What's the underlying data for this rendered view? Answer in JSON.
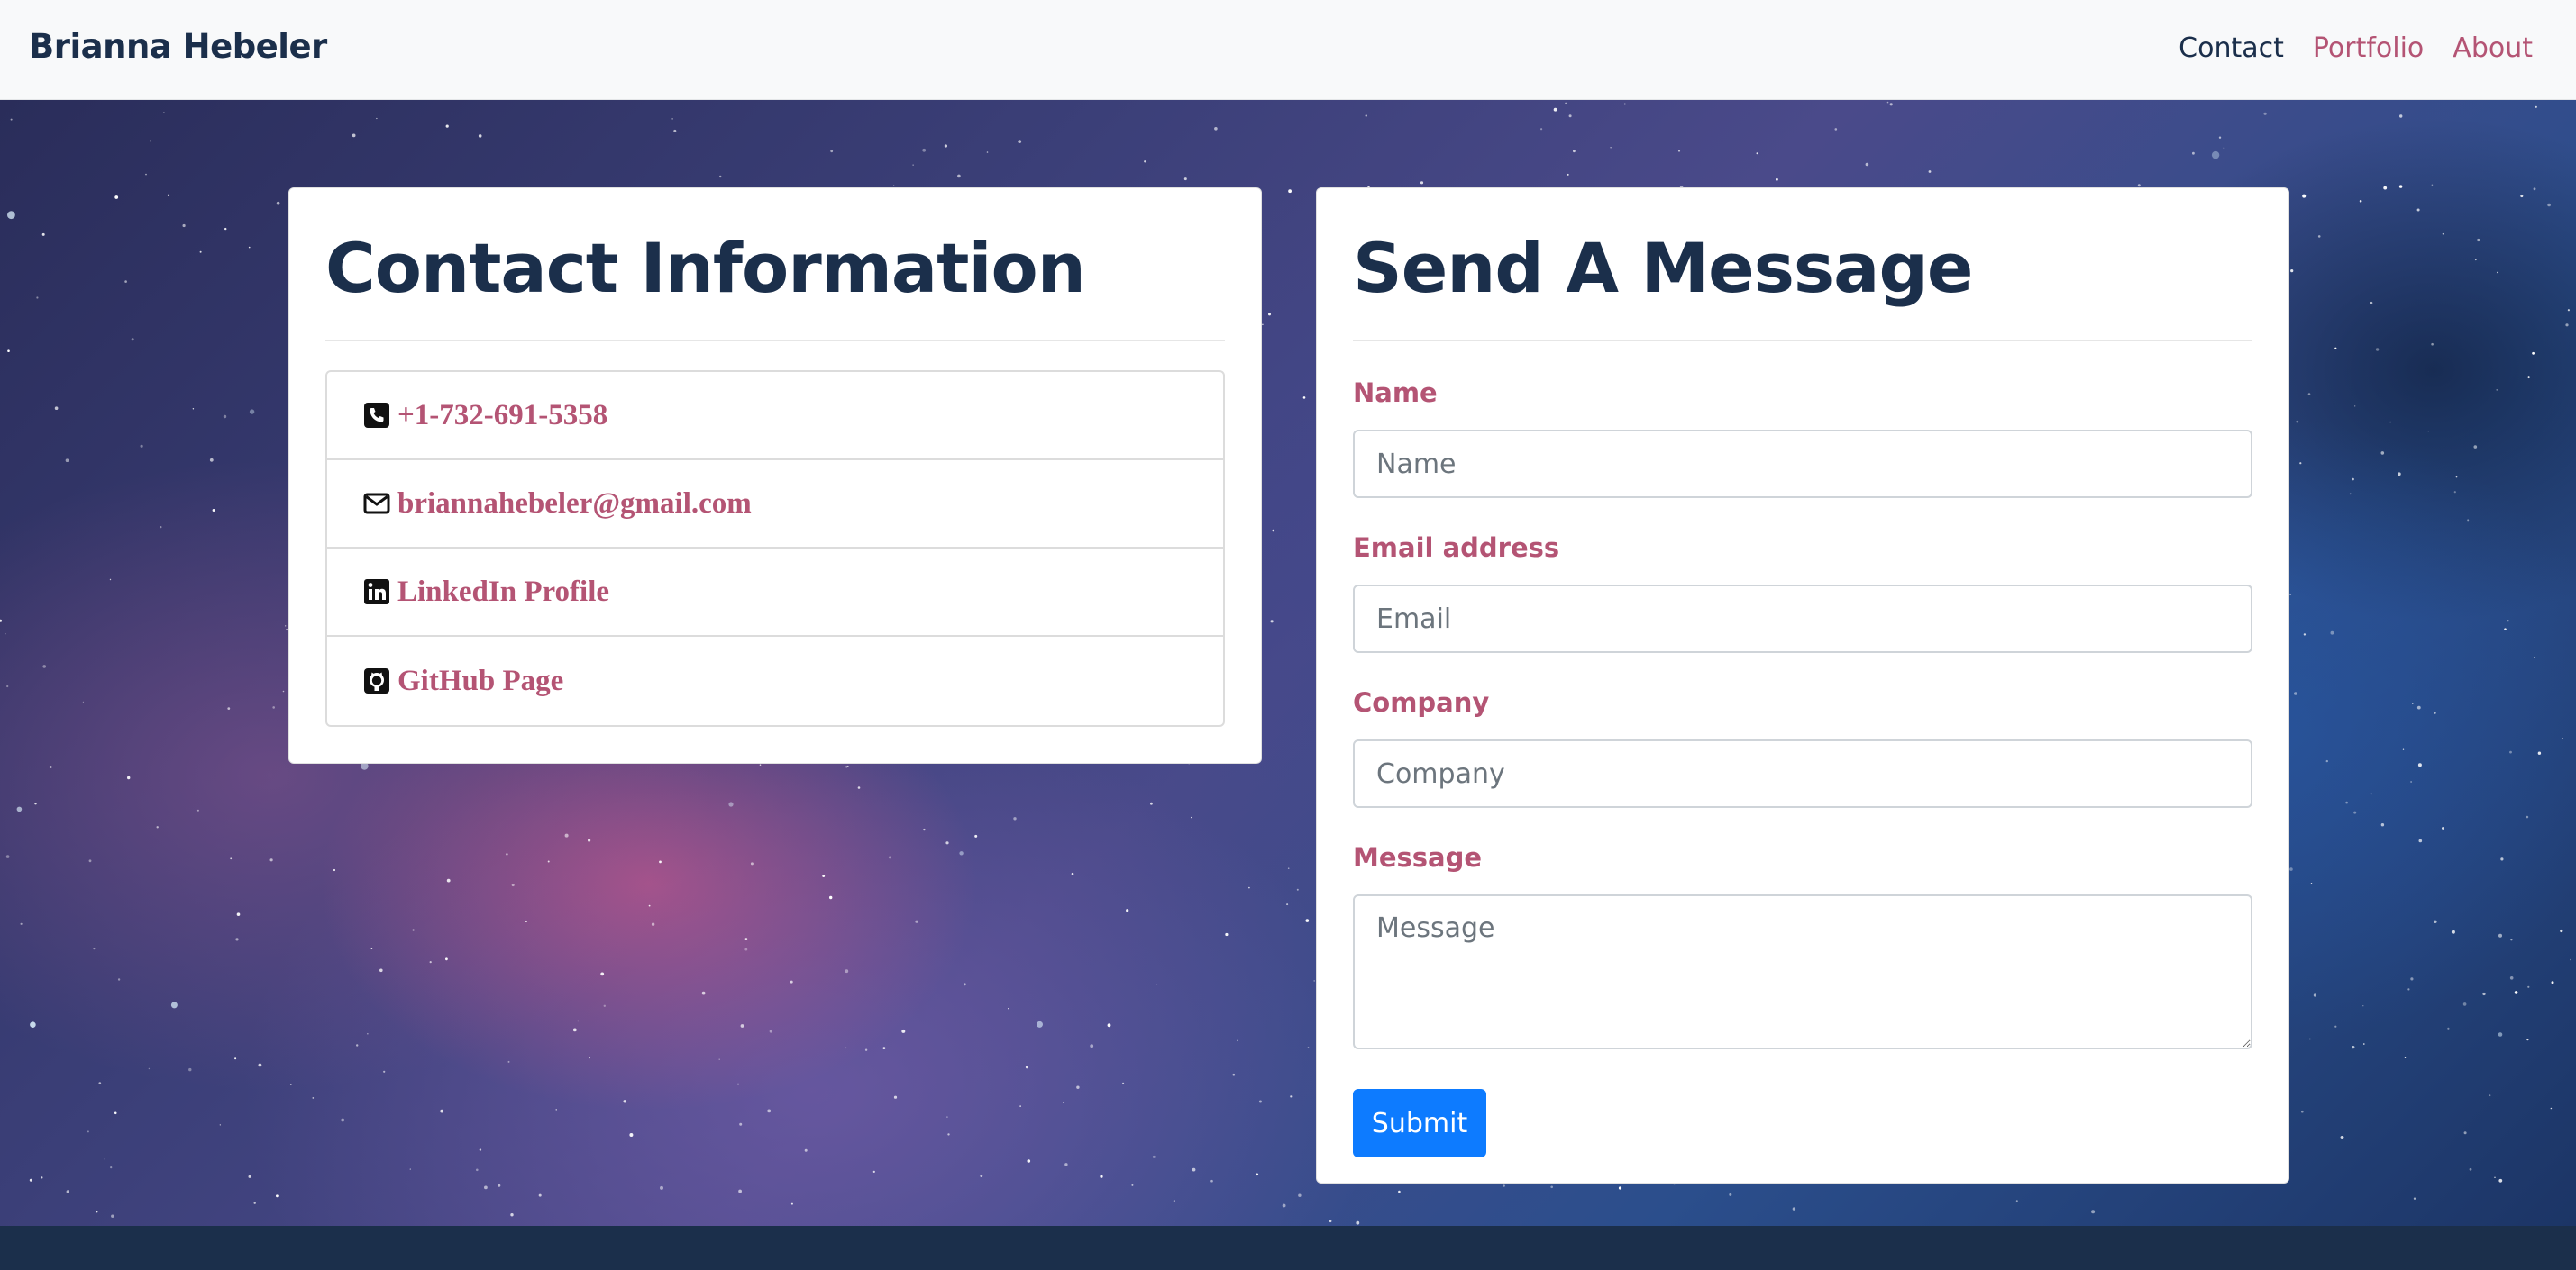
{
  "navbar": {
    "brand": "Brianna Hebeler",
    "links": [
      {
        "label": "Contact",
        "active": true
      },
      {
        "label": "Portfolio",
        "active": false
      },
      {
        "label": "About",
        "active": false
      }
    ]
  },
  "contact_card": {
    "title": "Contact Information",
    "items": [
      {
        "icon": "phone-icon",
        "label": "+1-732-691-5358"
      },
      {
        "icon": "envelope-icon",
        "label": "briannahebeler@gmail.com"
      },
      {
        "icon": "linkedin-icon",
        "label": "LinkedIn Profile"
      },
      {
        "icon": "github-icon",
        "label": "GitHub Page"
      }
    ]
  },
  "message_card": {
    "title": "Send A Message",
    "fields": {
      "name": {
        "label": "Name",
        "placeholder": "Name"
      },
      "email": {
        "label": "Email address",
        "placeholder": "Email"
      },
      "company": {
        "label": "Company",
        "placeholder": "Company"
      },
      "message": {
        "label": "Message",
        "placeholder": "Message"
      }
    },
    "submit_label": "Submit"
  },
  "colors": {
    "navy": "#1b2f4b",
    "accent": "#b45474",
    "button": "#0d7bff"
  }
}
